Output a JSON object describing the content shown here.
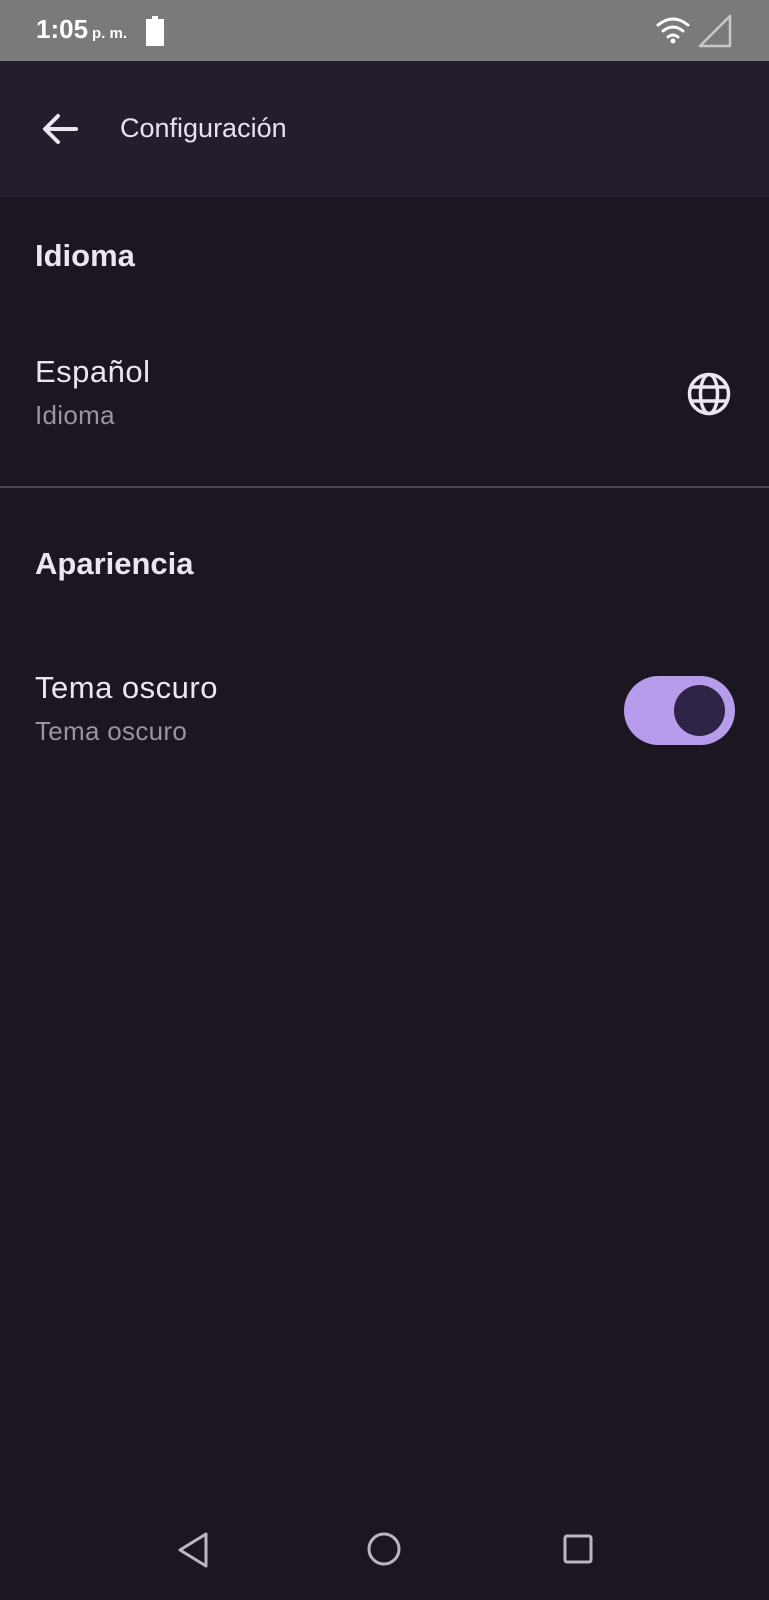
{
  "status_bar": {
    "time": "1:05",
    "ampm": "p. m."
  },
  "app_bar": {
    "title": "Configuración",
    "back_icon": "arrow-back-icon"
  },
  "sections": {
    "language": {
      "header": "Idioma",
      "item_title": "Español",
      "item_subtitle": "Idioma",
      "icon": "globe-icon"
    },
    "appearance": {
      "header": "Apariencia",
      "item_title": "Tema oscuro",
      "item_subtitle": "Tema oscuro",
      "toggle_on": true
    }
  },
  "colors": {
    "background": "#1b1620",
    "app_bar": "#241d2c",
    "status_bar": "#7a7a7a",
    "accent": "#b89cec",
    "switch_thumb": "#2f2446"
  }
}
